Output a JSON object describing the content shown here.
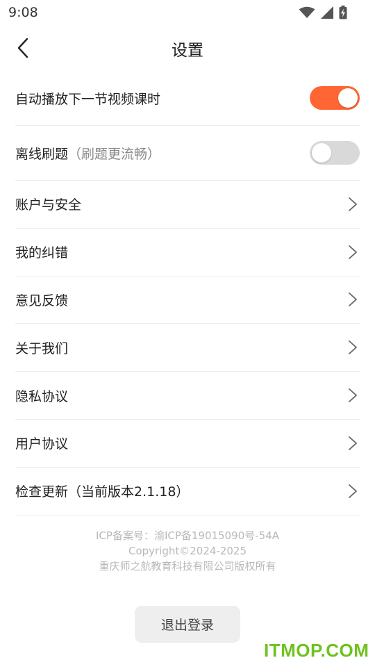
{
  "status_bar": {
    "time": "9:08",
    "icons": [
      "wifi-icon",
      "cellular-signal-icon",
      "battery-charging-icon"
    ]
  },
  "nav": {
    "title": "设置",
    "back_icon": "chevron-left-icon"
  },
  "colors": {
    "accent": "#FF6633",
    "toggle_off": "#d9d9d9",
    "footer_text": "#b8b8b8",
    "watermark": "#6ec21e"
  },
  "settings": {
    "autoplay": {
      "label": "自动播放下一节视频课时",
      "enabled": true
    },
    "offline": {
      "label": "离线刷题",
      "hint": "（刷题更流畅）",
      "enabled": false
    },
    "account": {
      "label": "账户与安全"
    },
    "corrections": {
      "label": "我的纠错"
    },
    "feedback": {
      "label": "意见反馈"
    },
    "about": {
      "label": "关于我们"
    },
    "privacy": {
      "label": "隐私协议"
    },
    "user_agreement": {
      "label": "用户协议"
    },
    "update": {
      "label": "检查更新（当前版本2.1.18）"
    }
  },
  "footer": {
    "icp": "ICP备案号：渝ICP备19015090号-54A",
    "copyright": "Copyright©2024-2025",
    "company": "重庆师之航教育科技有限公司版权所有"
  },
  "logout": {
    "label": "退出登录"
  },
  "watermark": {
    "text": "ITMOP.COM"
  }
}
